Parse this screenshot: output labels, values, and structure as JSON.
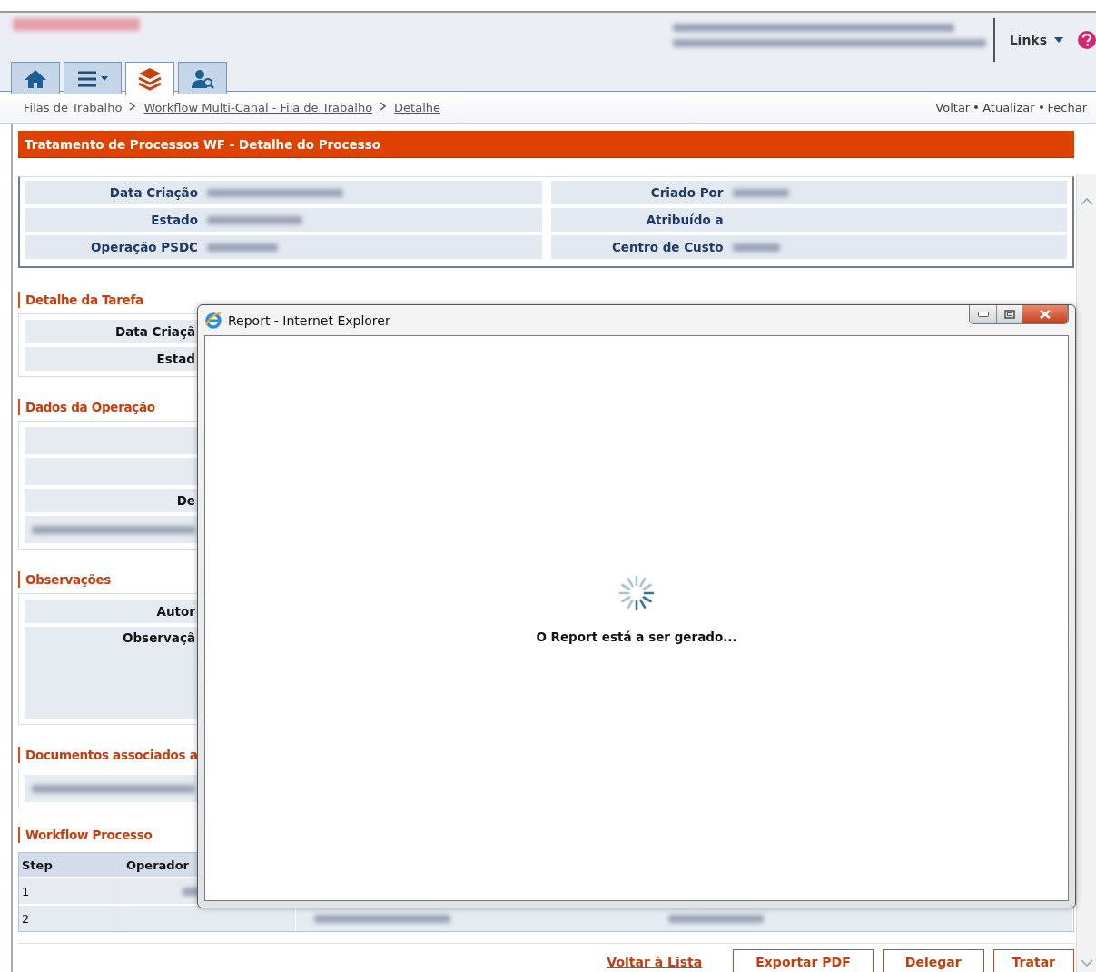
{
  "header": {
    "links_label": "Links"
  },
  "nav_tabs": [
    {
      "kind": "home",
      "selected": false
    },
    {
      "kind": "menu",
      "selected": false
    },
    {
      "kind": "layers",
      "selected": true
    },
    {
      "kind": "user-search",
      "selected": false
    }
  ],
  "breadcrumb": [
    {
      "label": "Filas de Trabalho",
      "link": false
    },
    {
      "label": "Workflow Multi-Canal - Fila de Trabalho",
      "link": true
    },
    {
      "label": "Detalhe",
      "link": true
    }
  ],
  "page_actions": [
    "Voltar",
    "Atualizar",
    "Fechar"
  ],
  "page_title": "Tratamento de Processos WF - Detalhe do Processo",
  "process_fields": [
    {
      "left": "Data Criação",
      "left_value": true,
      "right": "Criado Por",
      "right_value": true
    },
    {
      "left": "Estado",
      "left_value": true,
      "right": "Atribuído a",
      "right_value": false
    },
    {
      "left": "Operação PSDC",
      "left_value": true,
      "right": "Centro de Custo",
      "right_value": true
    }
  ],
  "sections": [
    {
      "title": "Detalhe da Tarefa",
      "rows": [
        {
          "kind": "label",
          "label": "Data Criaçã"
        },
        {
          "kind": "label",
          "label": "Estad"
        }
      ]
    },
    {
      "title": "Dados da Operação",
      "rows": [
        {
          "kind": "blank"
        },
        {
          "kind": "blank"
        },
        {
          "kind": "label",
          "label": "De"
        },
        {
          "kind": "blurred"
        }
      ]
    },
    {
      "title": "Observações",
      "rows": [
        {
          "kind": "label",
          "label": "Autor"
        },
        {
          "kind": "tall",
          "label": "Observaçã"
        }
      ]
    },
    {
      "title": "Documentos associados a",
      "rows": [
        {
          "kind": "blurred"
        }
      ]
    }
  ],
  "workflow": {
    "title": "Workflow Processo",
    "columns": [
      "Step",
      "Operador"
    ],
    "rows": [
      "1",
      "2"
    ]
  },
  "footer": {
    "link": "Voltar à Lista",
    "buttons": [
      "Exportar PDF",
      "Delegar",
      "Tratar"
    ]
  },
  "dialog": {
    "title": "Report - Internet Explorer",
    "message": "O Report está a ser gerado..."
  }
}
